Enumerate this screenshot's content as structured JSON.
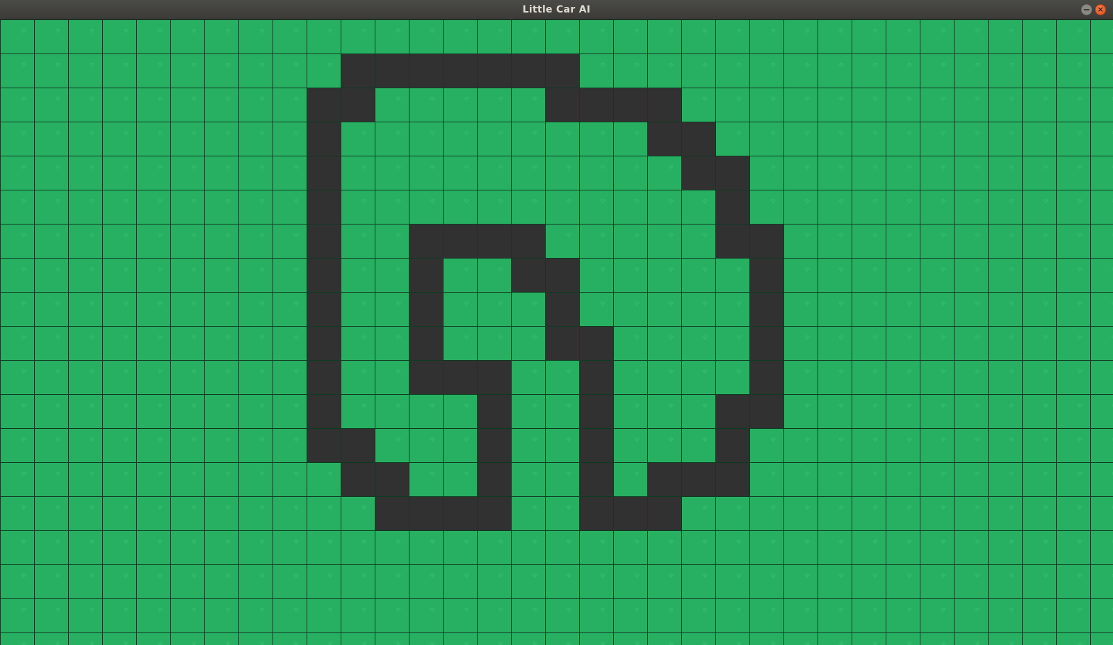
{
  "window": {
    "title": "Little Car AI",
    "close_glyph": "×"
  },
  "colors": {
    "grass": "#28b062",
    "grass_leaf": "#33bb6c",
    "grid_line": "#0f3a22",
    "track": "#313131"
  },
  "grid": {
    "columns": 33,
    "rows": 19,
    "track_cells": [
      [
        1,
        10
      ],
      [
        1,
        11
      ],
      [
        1,
        12
      ],
      [
        1,
        13
      ],
      [
        1,
        14
      ],
      [
        1,
        15
      ],
      [
        1,
        16
      ],
      [
        2,
        9
      ],
      [
        2,
        10
      ],
      [
        2,
        16
      ],
      [
        2,
        17
      ],
      [
        2,
        18
      ],
      [
        2,
        19
      ],
      [
        3,
        9
      ],
      [
        3,
        19
      ],
      [
        3,
        20
      ],
      [
        4,
        9
      ],
      [
        4,
        20
      ],
      [
        4,
        21
      ],
      [
        5,
        9
      ],
      [
        5,
        21
      ],
      [
        6,
        9
      ],
      [
        6,
        12
      ],
      [
        6,
        13
      ],
      [
        6,
        14
      ],
      [
        6,
        15
      ],
      [
        6,
        21
      ],
      [
        6,
        22
      ],
      [
        7,
        9
      ],
      [
        7,
        12
      ],
      [
        7,
        15
      ],
      [
        7,
        16
      ],
      [
        7,
        22
      ],
      [
        8,
        9
      ],
      [
        8,
        12
      ],
      [
        8,
        16
      ],
      [
        8,
        22
      ],
      [
        9,
        9
      ],
      [
        9,
        12
      ],
      [
        9,
        16
      ],
      [
        9,
        17
      ],
      [
        9,
        22
      ],
      [
        10,
        9
      ],
      [
        10,
        12
      ],
      [
        10,
        13
      ],
      [
        10,
        14
      ],
      [
        10,
        17
      ],
      [
        10,
        22
      ],
      [
        11,
        9
      ],
      [
        11,
        14
      ],
      [
        11,
        17
      ],
      [
        11,
        21
      ],
      [
        11,
        22
      ],
      [
        12,
        9
      ],
      [
        12,
        10
      ],
      [
        12,
        14
      ],
      [
        12,
        17
      ],
      [
        12,
        21
      ],
      [
        13,
        10
      ],
      [
        13,
        11
      ],
      [
        13,
        14
      ],
      [
        13,
        17
      ],
      [
        13,
        19
      ],
      [
        13,
        20
      ],
      [
        13,
        21
      ],
      [
        14,
        11
      ],
      [
        14,
        12
      ],
      [
        14,
        13
      ],
      [
        14,
        14
      ],
      [
        14,
        17
      ],
      [
        14,
        18
      ],
      [
        14,
        19
      ]
    ]
  }
}
